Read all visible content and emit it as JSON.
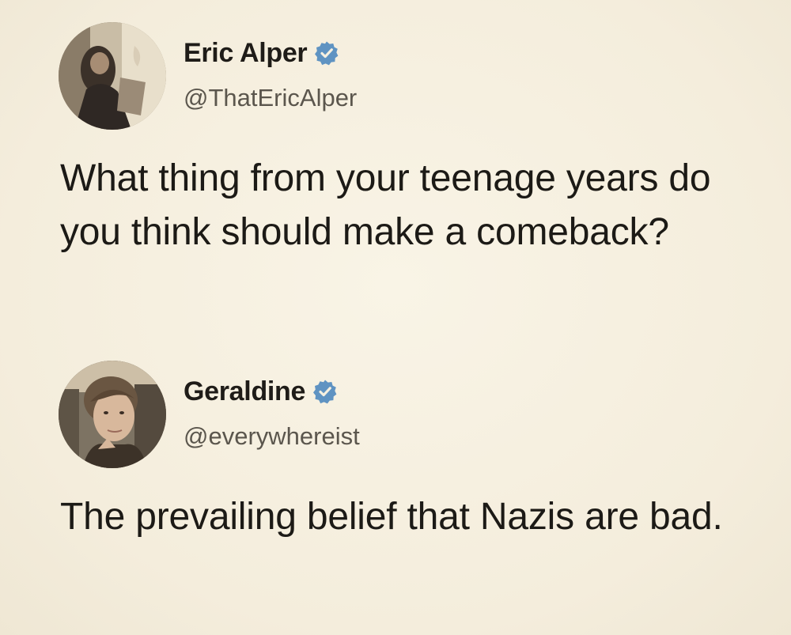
{
  "tweets": [
    {
      "author_name": "Eric Alper",
      "handle": "@ThatEricAlper",
      "text": "What thing from your teenage years do you think should make a comeback?",
      "verified_icon": "verified-badge-icon",
      "avatar": "profile-photo"
    },
    {
      "author_name": "Geraldine",
      "handle": "@everywhereist",
      "text": "The prevailing belief that Nazis are bad.",
      "verified_icon": "verified-badge-icon",
      "avatar": "profile-photo"
    }
  ],
  "colors": {
    "background": "#f6f0e0",
    "verified_badge": "#5f93c2",
    "name_text": "#1f1c18",
    "handle_text": "#5b564d"
  }
}
